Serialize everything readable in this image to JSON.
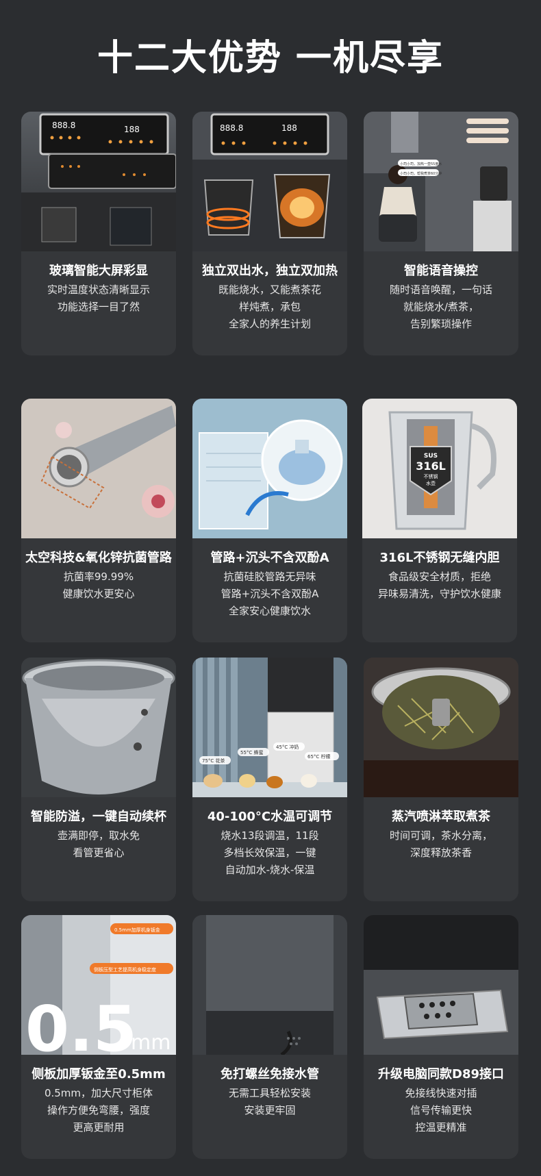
{
  "page": {
    "title": "十二大优势 一机尽享"
  },
  "cards": [
    {
      "title": "玻璃智能大屏彩显",
      "lines": [
        "实时温度状态清晰显示",
        "功能选择一目了然"
      ],
      "display_left": "888.8",
      "display_right": "188"
    },
    {
      "title": "独立双出水，独立双加热",
      "lines": [
        "既能烧水，又能煮茶花",
        "样炖煮，承包",
        "全家人的养生计划"
      ],
      "display_left": "888.8",
      "display_right": "188"
    },
    {
      "title": "智能语音操控",
      "lines": [
        "随时语音唤醒，一句话",
        "就能烧水/煮茶，",
        "告别繁琐操作"
      ],
      "bubble_1": "小司小司，加热一壶55度水",
      "bubble_2": "小司小司，帮我煮茶60分钟"
    },
    {
      "title": "太空科技&氧化锌抗菌管路",
      "lines": [
        "抗菌率99.99%",
        "健康饮水更安心"
      ]
    },
    {
      "title": "管路+沉头不含双酚A",
      "lines": [
        "抗菌硅胶管路无异味",
        "管路+沉头不含双酚A",
        "全家安心健康饮水"
      ]
    },
    {
      "title": "316L不锈钢无缝内胆",
      "lines": [
        "食品级安全材质，拒绝",
        "异味易清洗，守护饮水健康"
      ],
      "badge_top": "SUS",
      "badge_mid": "316L",
      "badge_line1": "不锈钢",
      "badge_line2": "水壶"
    },
    {
      "title": "智能防溢，一键自动续杯",
      "lines": [
        "壶满即停，取水免",
        "看管更省心"
      ]
    },
    {
      "title": "40-100°C水温可调节",
      "lines": [
        "烧水13段调温，11段",
        "多档长效保温，一键",
        "自动加水-烧水-保温"
      ],
      "temps": [
        "75°C 花茶",
        "55°C 蜂蜜",
        "45°C 冲奶",
        "65°C 柠檬"
      ]
    },
    {
      "title": "蒸汽喷淋萃取煮茶",
      "lines": [
        "时间可调，茶水分离，",
        "深度释放茶香"
      ]
    },
    {
      "title": "侧板加厚钣金至0.5mm",
      "lines": [
        "0.5mm，加大尺寸柜体",
        "操作方便免弯腰，强度",
        "更高更耐用"
      ],
      "big_number": "0.5",
      "big_unit": "mm",
      "tag_1": "0.5mm加厚机身钣金",
      "tag_2": "侧板压型工艺提高机身稳定度"
    },
    {
      "title": "免打螺丝免接水管",
      "lines": [
        "无需工具轻松安装",
        "安装更牢固"
      ]
    },
    {
      "title": "升级电脑同款D89接口",
      "lines": [
        "免接线快速对插",
        "信号传输更快",
        "控温更精准"
      ]
    }
  ],
  "colors": {
    "background": "#2b2d30",
    "card": "#35373a",
    "accent_orange": "#f0882a"
  }
}
